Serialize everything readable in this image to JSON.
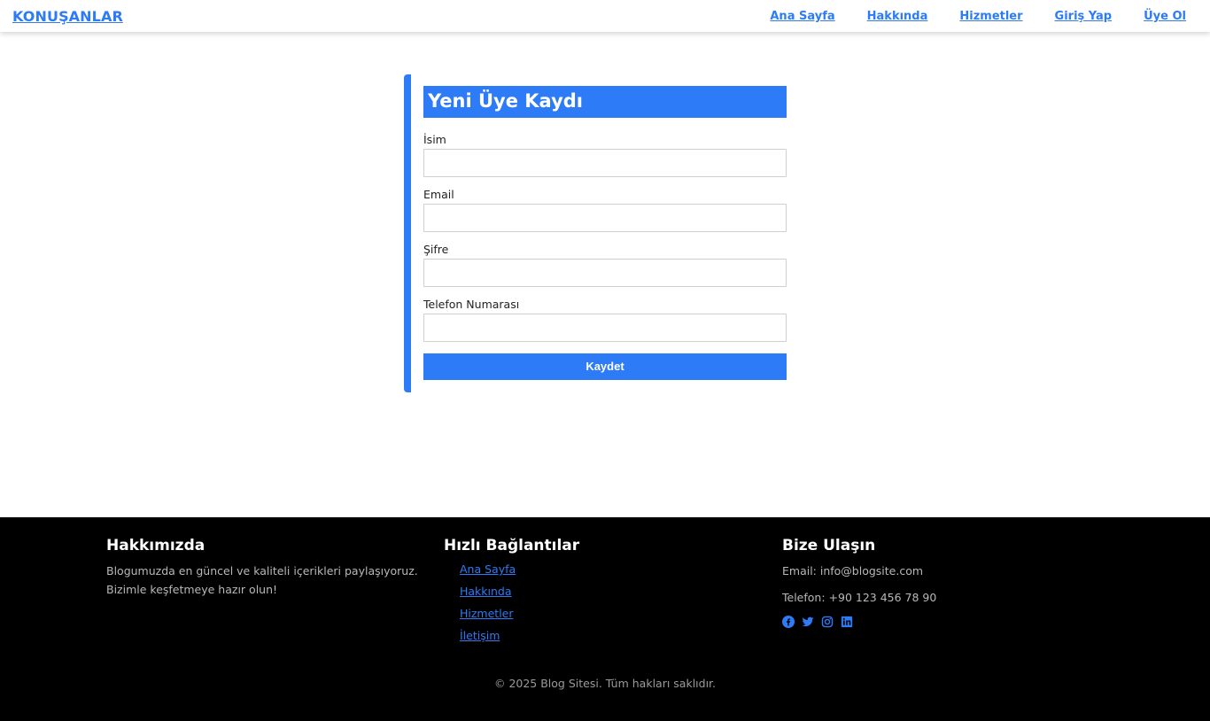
{
  "navbar": {
    "brand": "KONUŞANLAR",
    "links": [
      "Ana Sayfa",
      "Hakkında",
      "Hizmetler",
      "Giriş Yap",
      "Üye Ol"
    ]
  },
  "form": {
    "title": "Yeni Üye Kaydı",
    "fields": [
      {
        "label": "İsim",
        "value": ""
      },
      {
        "label": "Email",
        "value": ""
      },
      {
        "label": "Şifre",
        "value": ""
      },
      {
        "label": "Telefon Numarası",
        "value": ""
      }
    ],
    "submit_label": "Kaydet"
  },
  "footer": {
    "about": {
      "title": "Hakkımızda",
      "text_line1": "Blogumuzda en güncel ve kaliteli içerikleri paylaşıyoruz.",
      "text_line2": "Bizimle keşfetmeye hazır olun!"
    },
    "quick_links": {
      "title": "Hızlı Bağlantılar",
      "items": [
        "Ana Sayfa",
        "Hakkında",
        "Hizmetler",
        "İletişim"
      ]
    },
    "contact": {
      "title": "Bize Ulaşın",
      "email": "Email: info@blogsite.com",
      "phone": "Telefon: +90 123 456 78 90",
      "social_icons": [
        "facebook-icon",
        "twitter-icon",
        "instagram-icon",
        "linkedin-icon"
      ]
    },
    "copyright": "© 2025 Blog Sitesi. Tüm hakları saklıdır."
  },
  "colors": {
    "accent": "#2d7bf6",
    "footer_bg": "#000000"
  }
}
